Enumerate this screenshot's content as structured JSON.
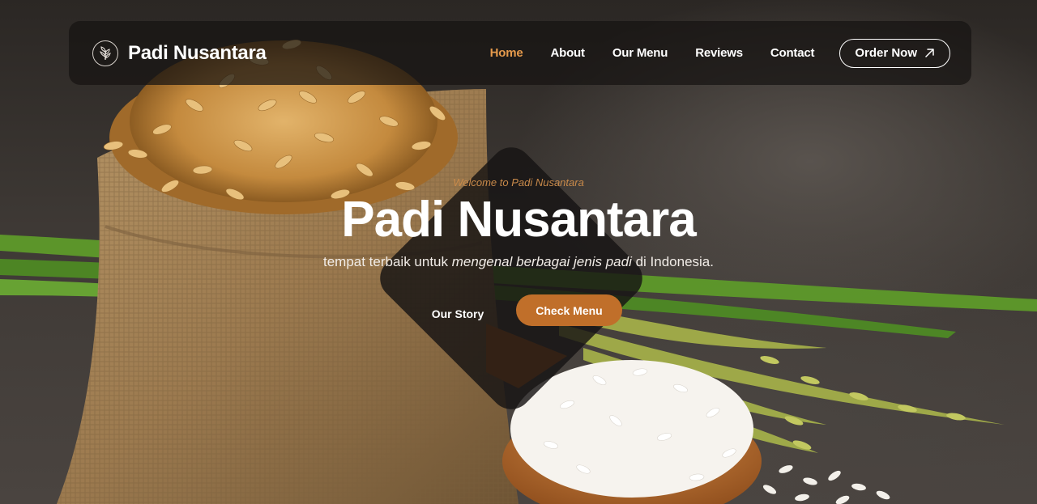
{
  "brand": {
    "name": "Padi Nusantara",
    "logo_icon": "rice-plant-icon"
  },
  "nav": {
    "links": [
      {
        "label": "Home",
        "active": true
      },
      {
        "label": "About",
        "active": false
      },
      {
        "label": "Our Menu",
        "active": false
      },
      {
        "label": "Reviews",
        "active": false
      },
      {
        "label": "Contact",
        "active": false
      }
    ],
    "order_button": {
      "label": "Order Now",
      "icon": "arrow-up-right-icon"
    }
  },
  "hero": {
    "eyebrow": "Welcome to Padi Nusantara",
    "title": "Padi Nusantara",
    "subtitle_part1": "tempat terbaik untuk ",
    "subtitle_emphasis": "mengenal berbagai jenis padi",
    "subtitle_part2": " di Indonesia.",
    "primary_button": "Check Menu",
    "secondary_button": "Our Story"
  },
  "colors": {
    "accent": "#e59a4c",
    "button": "#c06f2a",
    "navbar_bg": "#161412",
    "text": "#ffffff"
  }
}
